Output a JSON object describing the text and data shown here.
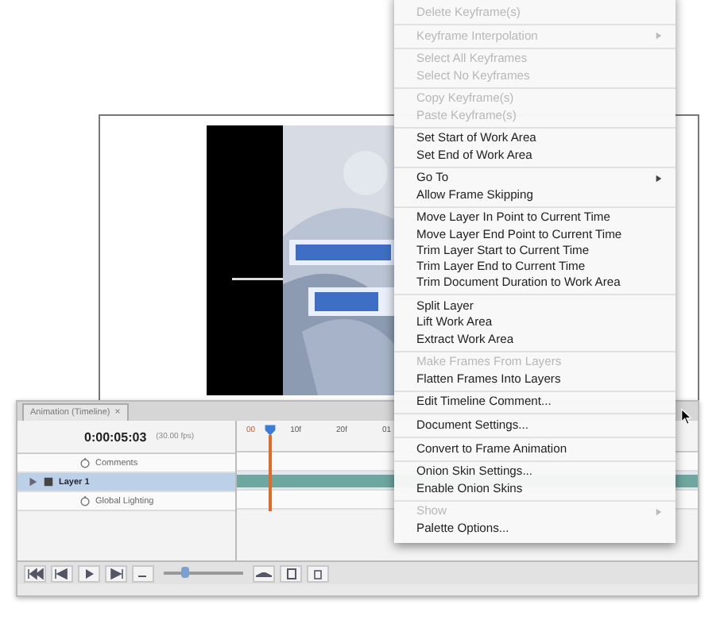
{
  "timeline": {
    "tab": "Animation (Timeline)",
    "tab_close": "×",
    "timecode": "0:00:05:03",
    "fps": "(30.00 fps)",
    "ruler_labels": [
      "00",
      "10f",
      "20f",
      "01"
    ],
    "layers": [
      {
        "name": "Comments",
        "selected": false,
        "kind": "property"
      },
      {
        "name": "Layer 1",
        "selected": true,
        "kind": "layer"
      },
      {
        "name": "Global Lighting",
        "selected": false,
        "kind": "property"
      }
    ],
    "zoom_slider": {
      "level": 0.25
    }
  },
  "menu": {
    "groups": [
      [
        {
          "label": "Delete Keyframe(s)",
          "disabled": true,
          "submenu": false
        }
      ],
      [
        {
          "label": "Keyframe Interpolation",
          "disabled": true,
          "submenu": true
        }
      ],
      [
        {
          "label": "Select All Keyframes",
          "disabled": true,
          "submenu": false
        },
        {
          "label": "Select No Keyframes",
          "disabled": true,
          "submenu": false
        }
      ],
      [
        {
          "label": "Copy Keyframe(s)",
          "disabled": true,
          "submenu": false
        },
        {
          "label": "Paste Keyframe(s)",
          "disabled": true,
          "submenu": false
        }
      ],
      [
        {
          "label": "Set Start of Work Area",
          "disabled": false,
          "submenu": false
        },
        {
          "label": "Set End of Work Area",
          "disabled": false,
          "submenu": false
        }
      ],
      [
        {
          "label": "Go To",
          "disabled": false,
          "submenu": true
        },
        {
          "label": "Allow Frame Skipping",
          "disabled": false,
          "submenu": false
        }
      ],
      [
        {
          "label": "Move Layer In Point to Current Time",
          "disabled": false,
          "submenu": false
        },
        {
          "label": "Move Layer End Point to Current Time",
          "disabled": false,
          "submenu": false
        },
        {
          "label": "Trim Layer Start to Current Time",
          "disabled": false,
          "submenu": false
        },
        {
          "label": "Trim Layer End to Current Time",
          "disabled": false,
          "submenu": false
        },
        {
          "label": "Trim Document Duration to Work Area",
          "disabled": false,
          "submenu": false
        }
      ],
      [
        {
          "label": "Split Layer",
          "disabled": false,
          "submenu": false
        },
        {
          "label": "Lift Work Area",
          "disabled": false,
          "submenu": false
        },
        {
          "label": "Extract Work Area",
          "disabled": false,
          "submenu": false
        }
      ],
      [
        {
          "label": "Make Frames From Layers",
          "disabled": true,
          "submenu": false
        },
        {
          "label": "Flatten Frames Into Layers",
          "disabled": false,
          "submenu": false
        }
      ],
      [
        {
          "label": "Edit Timeline Comment...",
          "disabled": false,
          "submenu": false
        }
      ],
      [
        {
          "label": "Document Settings...",
          "disabled": false,
          "submenu": false
        }
      ],
      [
        {
          "label": "Convert to Frame Animation",
          "disabled": false,
          "submenu": false
        }
      ],
      [
        {
          "label": "Onion Skin Settings...",
          "disabled": false,
          "submenu": false
        },
        {
          "label": "Enable Onion Skins",
          "disabled": false,
          "submenu": false
        }
      ],
      [
        {
          "label": "Show",
          "disabled": true,
          "submenu": true
        },
        {
          "label": "Palette Options...",
          "disabled": false,
          "submenu": false
        }
      ]
    ]
  }
}
